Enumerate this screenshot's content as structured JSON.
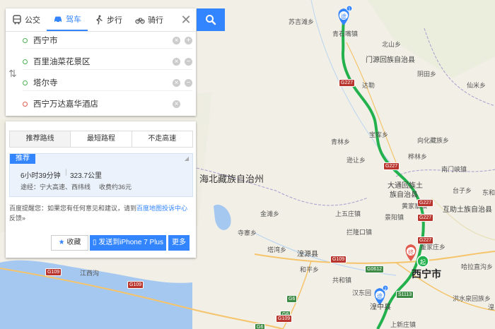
{
  "modes": [
    {
      "label": "公交",
      "icon": "bus-icon"
    },
    {
      "label": "驾车",
      "icon": "car-icon"
    },
    {
      "label": "步行",
      "icon": "walk-icon"
    },
    {
      "label": "骑行",
      "icon": "bike-icon"
    }
  ],
  "active_mode": "驾车",
  "close_label": "✕",
  "swap_label": "⇅",
  "stops": [
    {
      "name": "西宁市",
      "type": "start"
    },
    {
      "name": "百里油菜花景区",
      "type": "waypoint"
    },
    {
      "name": "塔尔寺",
      "type": "waypoint"
    },
    {
      "name": "西宁万达嘉华酒店",
      "type": "end"
    }
  ],
  "route_tabs": [
    "推荐路线",
    "最短路程",
    "不走高速"
  ],
  "route": {
    "tag": "推荐",
    "time": "6小时39分钟",
    "distance": "323.7公里",
    "via": "途经：宁大高速、西纬线",
    "fee": "收费约36元"
  },
  "tip": {
    "prefix": "百度提醒您：如果您有任何意见和建议，请到",
    "link": "百度地图投诉中心",
    "suffix": "反馈»"
  },
  "buttons": {
    "favorite": "收藏",
    "send": "发送到iPhone 7 Plus",
    "more": "更多"
  },
  "markers": {
    "waypoint": "途",
    "start": "起",
    "end": "终",
    "waypoint_badges": [
      "1",
      "2"
    ]
  },
  "colors": {
    "accent": "#3385ff",
    "route": "#22b14c",
    "water": "#a5c8f0",
    "highway": "#b8342c"
  },
  "map": {
    "labels": [
      {
        "text": "苏吉滩乡",
        "cls": ""
      },
      {
        "text": "青石嘴镇",
        "cls": ""
      },
      {
        "text": "北山乡",
        "cls": ""
      },
      {
        "text": "门源回族自治县",
        "cls": "mid"
      },
      {
        "text": "阴田乡",
        "cls": ""
      },
      {
        "text": "达勒",
        "cls": ""
      },
      {
        "text": "仙米乡",
        "cls": ""
      },
      {
        "text": "宝库乡",
        "cls": ""
      },
      {
        "text": "青林乡",
        "cls": ""
      },
      {
        "text": "向化藏族乡",
        "cls": ""
      },
      {
        "text": "桦林乡",
        "cls": ""
      },
      {
        "text": "逊让乡",
        "cls": ""
      },
      {
        "text": "南门峡镇",
        "cls": ""
      },
      {
        "text": "海北藏族自治州",
        "cls": "big"
      },
      {
        "text": "台子乡",
        "cls": ""
      },
      {
        "text": "大通回族土",
        "cls": "mid"
      },
      {
        "text": "族自治县",
        "cls": "mid"
      },
      {
        "text": "东和",
        "cls": ""
      },
      {
        "text": "黄家寨镇",
        "cls": ""
      },
      {
        "text": "互助土族自治县",
        "cls": "mid"
      },
      {
        "text": "金滩乡",
        "cls": ""
      },
      {
        "text": "上五庄镇",
        "cls": ""
      },
      {
        "text": "景阳镇",
        "cls": ""
      },
      {
        "text": "寺寨乡",
        "cls": ""
      },
      {
        "text": "拦隆口镇",
        "cls": ""
      },
      {
        "text": "塔湾乡",
        "cls": ""
      },
      {
        "text": "湟源县",
        "cls": "mid"
      },
      {
        "text": "董家庄乡",
        "cls": ""
      },
      {
        "text": "和平乡",
        "cls": ""
      },
      {
        "text": "西宁市",
        "cls": "city"
      },
      {
        "text": "哈拉直沟乡",
        "cls": ""
      },
      {
        "text": "江西沟",
        "cls": ""
      },
      {
        "text": "共和镇",
        "cls": ""
      },
      {
        "text": "汉东回",
        "cls": ""
      },
      {
        "text": "湟中县",
        "cls": ""
      },
      {
        "text": "洪水泉回族乡",
        "cls": ""
      },
      {
        "text": "上新庄镇",
        "cls": ""
      },
      {
        "text": "湟",
        "cls": ""
      }
    ],
    "road_shields": [
      "G227",
      "G227",
      "G227",
      "G227",
      "G227",
      "G109",
      "G109",
      "G109",
      "G0612",
      "S1113",
      "G6",
      "G6",
      "G109",
      "G6"
    ]
  }
}
